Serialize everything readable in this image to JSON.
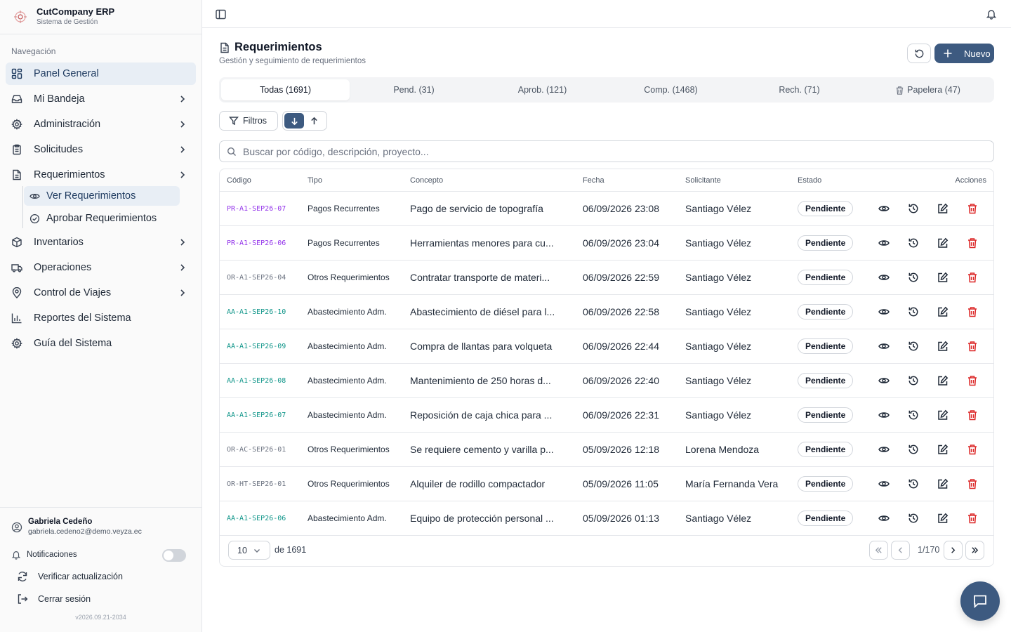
{
  "brand": {
    "title": "CutCompany ERP",
    "subtitle": "Sistema de Gestión"
  },
  "nav": {
    "caption": "Navegación",
    "items": [
      {
        "label": "Panel General",
        "icon": "dashboard-icon"
      },
      {
        "label": "Mi Bandeja",
        "icon": "inbox-icon"
      },
      {
        "label": "Administración",
        "icon": "gear-icon"
      },
      {
        "label": "Solicitudes",
        "icon": "clipboard-icon"
      },
      {
        "label": "Requerimientos",
        "icon": "document-icon"
      },
      {
        "label": "Inventarios",
        "icon": "package-icon"
      },
      {
        "label": "Operaciones",
        "icon": "truck-icon"
      },
      {
        "label": "Control de Viajes",
        "icon": "map-pin-icon"
      },
      {
        "label": "Reportes del Sistema",
        "icon": "bar-chart-icon"
      },
      {
        "label": "Guía del Sistema",
        "icon": "gear-icon"
      }
    ],
    "sub_items": [
      {
        "label": "Ver Requerimientos",
        "icon": "eye-icon"
      },
      {
        "label": "Aprobar Requerimientos",
        "icon": "check-circle-icon"
      }
    ]
  },
  "user": {
    "name": "Gabriela Cedeño",
    "email": "gabriela.cedeno2@demo.veyza.ec"
  },
  "footer": {
    "notifications_label": "Notificaciones",
    "notifications_enabled": false,
    "check_update": "Verificar actualización",
    "logout": "Cerrar sesión",
    "version": "v2026.09.21-2034"
  },
  "page": {
    "title": "Requerimientos",
    "subtitle": "Gestión y seguimiento de requerimientos",
    "new_label": "Nuevo"
  },
  "tabs": [
    {
      "label": "Todas (1691)",
      "active": true
    },
    {
      "label": "Pend. (31)",
      "active": false
    },
    {
      "label": "Aprob. (121)",
      "active": false
    },
    {
      "label": "Comp. (1468)",
      "active": false
    },
    {
      "label": "Rech. (71)",
      "active": false
    },
    {
      "label": "Papelera (47)",
      "active": false
    }
  ],
  "filters_label": "Filtros",
  "search": {
    "placeholder": "Buscar por código, descripción, proyecto...",
    "value": ""
  },
  "table": {
    "headers": {
      "code": "Código",
      "type": "Tipo",
      "concept": "Concepto",
      "date": "Fecha",
      "requester": "Solicitante",
      "status": "Estado",
      "actions": "Acciones"
    },
    "code_colors": {
      "PR": "#9333ea",
      "OR": "#6b7280",
      "AA": "#0d9488"
    },
    "rows": [
      {
        "code": "PR-A1-SEP26-07",
        "prefix": "PR",
        "type": "Pagos Recurrentes",
        "concept": "Pago de servicio de topografía",
        "date": "06/09/2026 23:08",
        "requester": "Santiago Vélez",
        "status": "Pendiente"
      },
      {
        "code": "PR-A1-SEP26-06",
        "prefix": "PR",
        "type": "Pagos Recurrentes",
        "concept": "Herramientas menores para cu...",
        "date": "06/09/2026 23:04",
        "requester": "Santiago Vélez",
        "status": "Pendiente"
      },
      {
        "code": "OR-A1-SEP26-04",
        "prefix": "OR",
        "type": "Otros Requerimientos",
        "concept": "Contratar transporte de materi...",
        "date": "06/09/2026 22:59",
        "requester": "Santiago Vélez",
        "status": "Pendiente"
      },
      {
        "code": "AA-A1-SEP26-10",
        "prefix": "AA",
        "type": "Abastecimiento Adm.",
        "concept": "Abastecimiento de diésel para l...",
        "date": "06/09/2026 22:58",
        "requester": "Santiago Vélez",
        "status": "Pendiente"
      },
      {
        "code": "AA-A1-SEP26-09",
        "prefix": "AA",
        "type": "Abastecimiento Adm.",
        "concept": "Compra de llantas para volqueta",
        "date": "06/09/2026 22:44",
        "requester": "Santiago Vélez",
        "status": "Pendiente"
      },
      {
        "code": "AA-A1-SEP26-08",
        "prefix": "AA",
        "type": "Abastecimiento Adm.",
        "concept": "Mantenimiento de 250 horas d...",
        "date": "06/09/2026 22:40",
        "requester": "Santiago Vélez",
        "status": "Pendiente"
      },
      {
        "code": "AA-A1-SEP26-07",
        "prefix": "AA",
        "type": "Abastecimiento Adm.",
        "concept": "Reposición de caja chica para ...",
        "date": "06/09/2026 22:31",
        "requester": "Santiago Vélez",
        "status": "Pendiente"
      },
      {
        "code": "OR-AC-SEP26-01",
        "prefix": "OR",
        "type": "Otros Requerimientos",
        "concept": "Se requiere cemento y varilla p...",
        "date": "05/09/2026 12:18",
        "requester": "Lorena Mendoza",
        "status": "Pendiente"
      },
      {
        "code": "OR-HT-SEP26-01",
        "prefix": "OR",
        "type": "Otros Requerimientos",
        "concept": "Alquiler de rodillo compactador",
        "date": "05/09/2026 11:05",
        "requester": "María Fernanda Vera",
        "status": "Pendiente"
      },
      {
        "code": "AA-A1-SEP26-06",
        "prefix": "AA",
        "type": "Abastecimiento Adm.",
        "concept": "Equipo de protección personal ...",
        "date": "05/09/2026 01:13",
        "requester": "Santiago Vélez",
        "status": "Pendiente"
      }
    ]
  },
  "pagination": {
    "page_size": "10",
    "of_total": "de 1691",
    "page_info": "1/170"
  },
  "colors": {
    "primary": "#3d5a80",
    "danger": "#dc2626",
    "active_bg": "#e8eef5"
  }
}
